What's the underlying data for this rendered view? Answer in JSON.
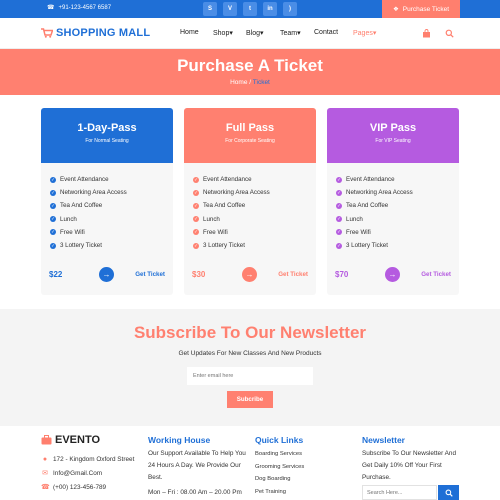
{
  "colors": {
    "primary": "#1f6fd6",
    "accent": "#ff8070",
    "purple": "#b55be0"
  },
  "topbar": {
    "phone": "+91-123-4567 6587",
    "socials": [
      "skype",
      "vimeo",
      "twitter",
      "linkedin",
      "rss"
    ],
    "cta": "Purchase Ticket"
  },
  "header": {
    "logo": "SHOPPING MALL",
    "nav": [
      "Home",
      "Shop",
      "Blog",
      "Team",
      "Contact",
      "Pages"
    ]
  },
  "banner": {
    "title": "Purchase A Ticket",
    "crumb_home": "Home",
    "crumb_sep": " / ",
    "crumb_current": "Ticket"
  },
  "pricing": {
    "cards": [
      {
        "name": "1-Day-Pass",
        "sub": "For Normal Seating",
        "price": "$22",
        "cta": "Get Ticket"
      },
      {
        "name": "Full Pass",
        "sub": "For Corporate Seating",
        "price": "$30",
        "cta": "Get Ticket"
      },
      {
        "name": "VIP Pass",
        "sub": "For VIP Seating",
        "price": "$70",
        "cta": "Get Ticket"
      }
    ],
    "features": [
      "Event Attendance",
      "Networking Area Access",
      "Tea And Coffee",
      "Lunch",
      "Free Wifi",
      "3 Lottery Ticket"
    ]
  },
  "newsletter": {
    "title": "Subscribe To Our Newsletter",
    "sub": "Get Updates For New Classes And New Products",
    "placeholder": "Enter email here",
    "button": "Subcribe"
  },
  "footer": {
    "brand": "EVENTO",
    "address": "172 - Kingdom Oxford Street",
    "email": "Info@Gmail.Com",
    "phone": "(+00) 123-456-789",
    "working_title": "Working House",
    "working_text": "Our Support Available To Help You 24 Hours A Day. We Provide Our Best.",
    "working_hours": "Mon – Fri : 08.00 Am – 20.00 Pm",
    "links_title": "Quick Links",
    "links": [
      "Boarding Services",
      "Grooming Services",
      "Dog Boarding",
      "Pet Training"
    ],
    "news_title": "Newsletter",
    "news_text": "Subscribe To Our Newsletter And Get Daily 10% Off Your First Purchase.",
    "search_placeholder": "Search Here..."
  }
}
